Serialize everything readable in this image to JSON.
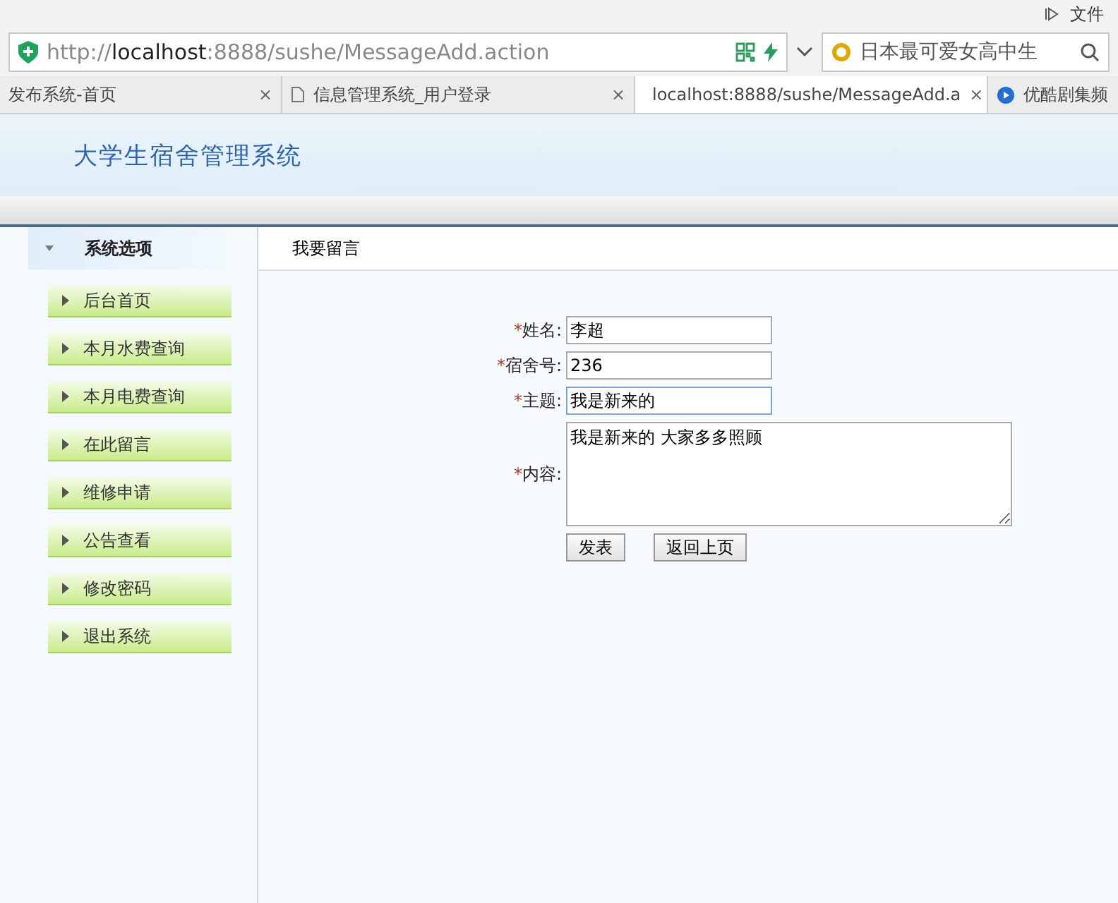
{
  "browser": {
    "menu_label": "文件",
    "address": {
      "scheme": "http://",
      "host": "localhost",
      "rest": ":8888/sushe/MessageAdd.action"
    },
    "search": {
      "value": "日本最可爱女高中生"
    },
    "tabs": [
      {
        "title": "发布系统-首页",
        "selected": false,
        "close": "×"
      },
      {
        "title": "信息管理系统_用户登录",
        "selected": false,
        "close": "×"
      },
      {
        "title": "localhost:8888/sushe/MessageAdd.a",
        "selected": true,
        "close": "×"
      },
      {
        "title": "优酷剧集频",
        "selected": false
      }
    ]
  },
  "page": {
    "title": "大学生宿舍管理系统",
    "sidebar": {
      "heading": "系统选项",
      "items": [
        {
          "label": "后台首页"
        },
        {
          "label": "本月水费查询"
        },
        {
          "label": "本月电费查询"
        },
        {
          "label": "在此留言"
        },
        {
          "label": "维修申请"
        },
        {
          "label": "公告查看"
        },
        {
          "label": "修改密码"
        },
        {
          "label": "退出系统"
        }
      ]
    },
    "content": {
      "heading": "我要留言",
      "fields": [
        {
          "kind": "input",
          "mark": "*",
          "label": "姓名:",
          "value": "李超",
          "focused": false
        },
        {
          "kind": "input",
          "mark": "*",
          "label": "宿舍号:",
          "value": "236",
          "focused": false
        },
        {
          "kind": "input",
          "mark": "*",
          "label": "主题:",
          "value": "我是新来的",
          "focused": true
        },
        {
          "kind": "textarea",
          "mark": "*",
          "label": "内容:",
          "value": "我是新来的 大家多多照顾",
          "focused": false
        }
      ],
      "buttons": [
        "发表",
        "返回上页"
      ]
    }
  }
}
